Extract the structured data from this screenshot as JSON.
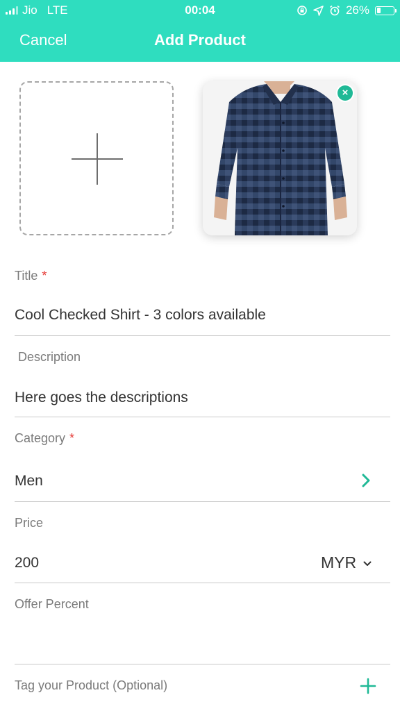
{
  "status_bar": {
    "carrier": "Jio",
    "network": "LTE",
    "time": "00:04",
    "battery": "26%",
    "battery_level": 0.26
  },
  "nav": {
    "cancel_label": "Cancel",
    "title": "Add Product"
  },
  "photos": {
    "add_icon": "plus-icon",
    "remove_icon": "close-icon"
  },
  "form": {
    "title": {
      "label": "Title",
      "required_mark": "*",
      "value": "Cool Checked Shirt - 3 colors available"
    },
    "description": {
      "label": "Description",
      "value": "Here goes the descriptions"
    },
    "category": {
      "label": "Category",
      "required_mark": "*",
      "value": "Men",
      "icon": "chevron-right-icon"
    },
    "price": {
      "label": "Price",
      "value": "200",
      "currency": "MYR",
      "currency_icon": "chevron-down-icon"
    },
    "offer_percent": {
      "label": "Offer Percent",
      "value": ""
    },
    "tags": {
      "label": "Tag your Product (Optional)",
      "icon": "plus-icon"
    }
  },
  "colors": {
    "accent": "#2fddbf",
    "accent_dark": "#1fb996",
    "required": "#e53935"
  }
}
